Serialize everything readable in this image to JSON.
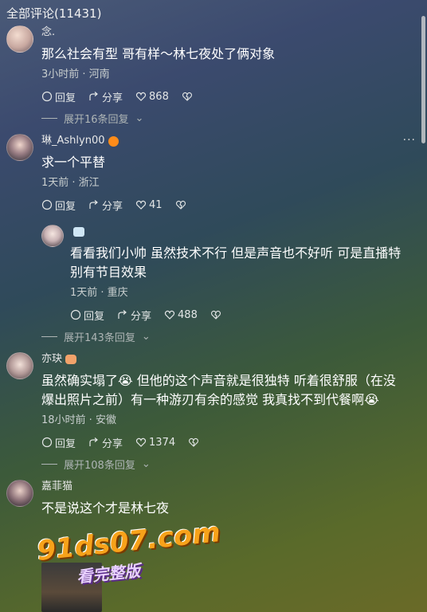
{
  "header": {
    "title": "全部评论(11431)"
  },
  "comments": [
    {
      "username": "念.",
      "text": "那么社会有型 哥有样～林七夜处了俩对象",
      "meta": "3小时前 · 河南",
      "reply_label": "回复",
      "share_label": "分享",
      "likes": "868",
      "expand": "展开16条回复"
    },
    {
      "username": "琳_Ashlyn00",
      "text": "求一个平替",
      "meta": "1天前 · 浙江",
      "reply_label": "回复",
      "share_label": "分享",
      "likes": "41",
      "more": "···"
    },
    {
      "username": "",
      "text": "看看我们小帅 虽然技术不行 但是声音也不好听 可是直播特别有节目效果",
      "meta": "1天前 · 重庆",
      "reply_label": "回复",
      "share_label": "分享",
      "likes": "488",
      "expand": "展开143条回复"
    },
    {
      "username": "亦玦",
      "text": "虽然确实塌了😭 但他的这个声音就是很独特 听着很舒服（在没爆出照片之前）有一种游刃有余的感觉 我真找不到代餐啊😭",
      "meta": "18小时前 · 安徽",
      "reply_label": "回复",
      "share_label": "分享",
      "likes": "1374",
      "expand": "展开108条回复"
    },
    {
      "username": "嘉菲猫",
      "text": "不是说这个才是林七夜"
    }
  ],
  "watermark": {
    "main": "91ds07.com",
    "sub": "看完整版"
  },
  "icons": {
    "comment": "comment-icon",
    "share": "share-icon",
    "like": "heart-icon",
    "dislike": "broken-heart-icon"
  }
}
